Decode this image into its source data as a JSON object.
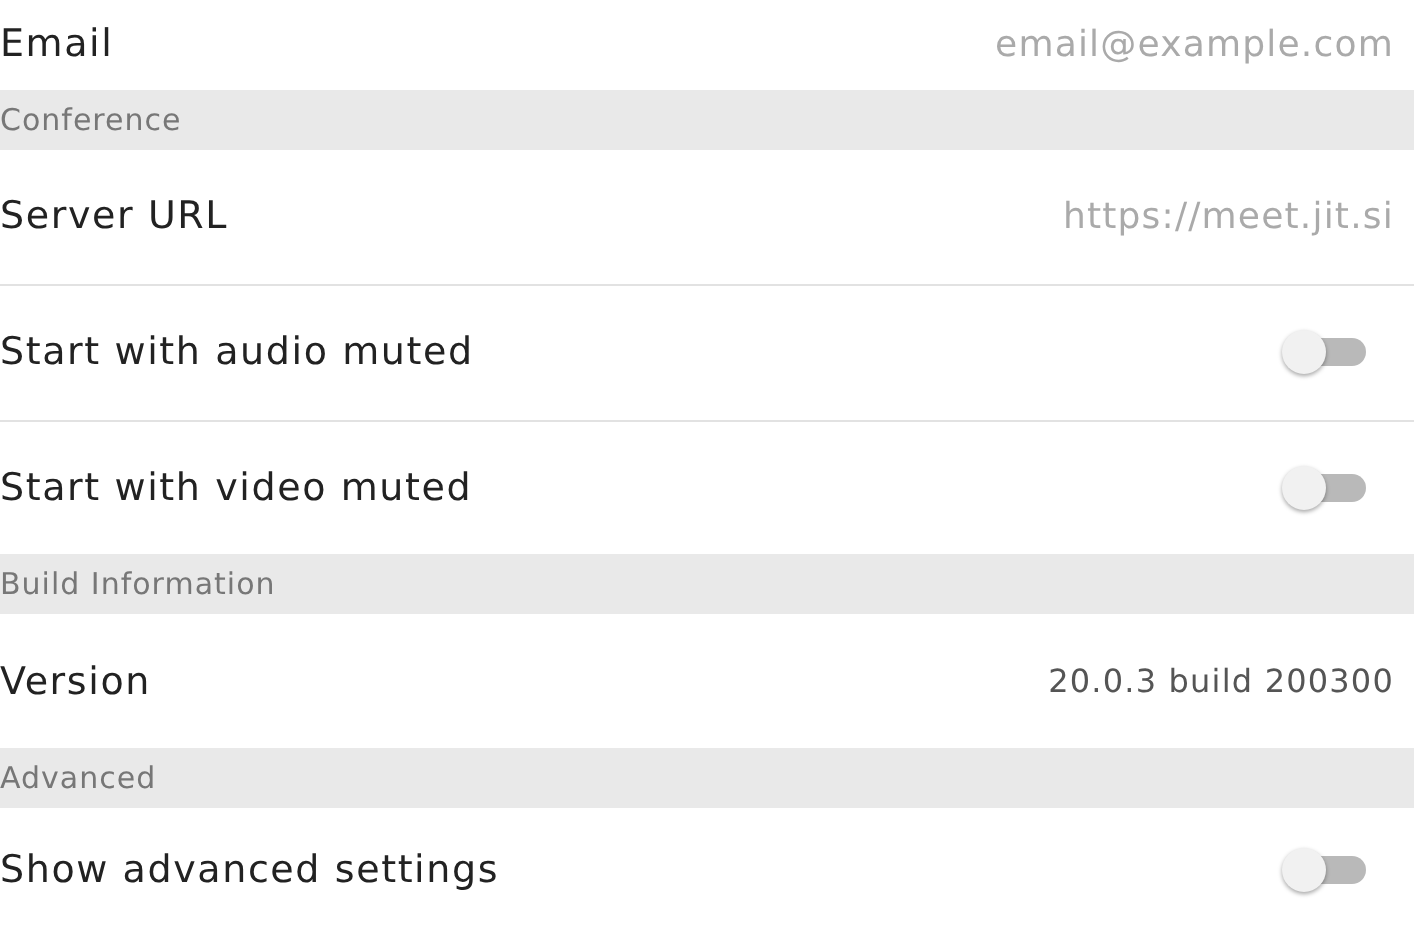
{
  "sections": [
    {
      "kind": "rows",
      "rows": [
        {
          "kind": "value",
          "label": "Email",
          "value": "email@example.com"
        }
      ]
    },
    {
      "kind": "header",
      "title": "Conference"
    },
    {
      "kind": "rows",
      "rows": [
        {
          "kind": "value",
          "label": "Server URL",
          "value": "https://meet.jit.si"
        },
        {
          "kind": "toggle",
          "label": "Start with audio muted",
          "on": false
        },
        {
          "kind": "toggle",
          "label": "Start with video muted",
          "on": false
        }
      ]
    },
    {
      "kind": "header",
      "title": "Build Information"
    },
    {
      "kind": "rows",
      "rows": [
        {
          "kind": "version",
          "label": "Version",
          "value": "20.0.3 build 200300"
        }
      ]
    },
    {
      "kind": "header",
      "title": "Advanced"
    },
    {
      "kind": "rows",
      "rows": [
        {
          "kind": "toggle",
          "label": "Show advanced settings",
          "on": false
        }
      ]
    }
  ]
}
